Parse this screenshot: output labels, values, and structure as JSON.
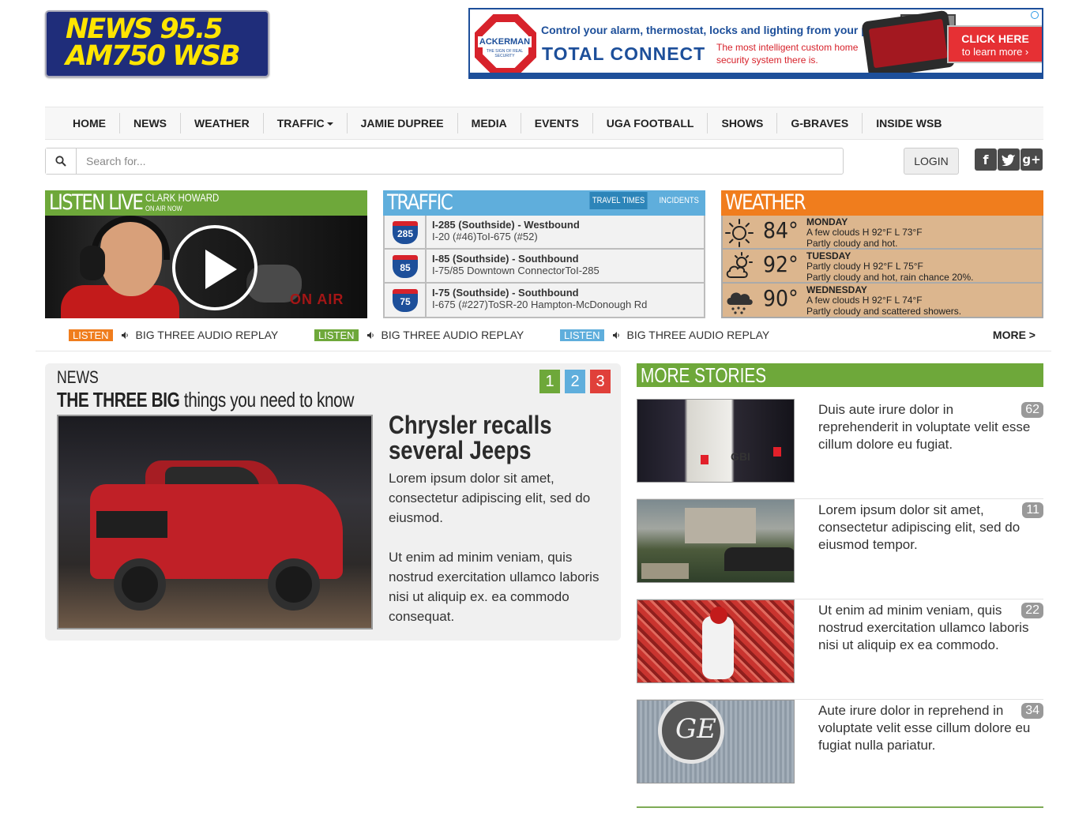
{
  "logo": {
    "line1": "NEWS 95.5",
    "line2": "AM750 WSB"
  },
  "ad": {
    "brand": "ACKERMAN",
    "brand_sub": "THE SIGN OF REAL SECURITY",
    "headline": "Control your alarm, thermostat, locks and lighting from your phone",
    "product": "TOTAL CONNECT",
    "tagline": "The most intelligent custom home security system there is.",
    "cta_line1": "CLICK HERE",
    "cta_line2": "to learn more ›"
  },
  "nav": {
    "items": [
      "HOME",
      "NEWS",
      "WEATHER",
      "TRAFFIC",
      "JAMIE DUPREE",
      "MEDIA",
      "EVENTS",
      "UGA FOOTBALL",
      "SHOWS",
      "G-BRAVES",
      "INSIDE WSB"
    ]
  },
  "search": {
    "placeholder": "Search for..."
  },
  "login_label": "LOGIN",
  "social": [
    "facebook-icon",
    "twitter-icon",
    "google-plus-icon"
  ],
  "listen_live": {
    "title": "LISTEN LIVE",
    "host": "CLARK HOWARD",
    "status": "ON AIR NOW",
    "sign": "ON AIR"
  },
  "traffic": {
    "title": "TRAFFIC",
    "tabs": [
      "TRAVEL TIMES",
      "INCIDENTS"
    ],
    "rows": [
      {
        "shield": "285",
        "route": "I-285 (Southside) - Westbound",
        "detail": "I-20 (#46)ToI-675 (#52)"
      },
      {
        "shield": "85",
        "route": "I-85 (Southside) - Southbound",
        "detail": "I-75/85 Downtown ConnectorToI-285"
      },
      {
        "shield": "75",
        "route": "I-75 (Southside) - Southbound",
        "detail": "I-675 (#227)ToSR-20 Hampton-McDonough Rd"
      }
    ]
  },
  "weather": {
    "title": "WEATHER",
    "days": [
      {
        "icon": "sunny-icon",
        "temp": "84°",
        "day": "MONDAY",
        "hilo": "A few clouds H 92°F L 73°F",
        "desc": "Partly cloudy and hot."
      },
      {
        "icon": "partly-cloudy-icon",
        "temp": "92°",
        "day": "TUESDAY",
        "hilo": "Partly cloudy H 92°F L 75°F",
        "desc": "Partly cloudy and hot, rain chance 20%."
      },
      {
        "icon": "rain-cloud-icon",
        "temp": "90°",
        "day": "WEDNESDAY",
        "hilo": "A few clouds H 92°F L 74°F",
        "desc": "Partly cloudy and scattered showers."
      }
    ]
  },
  "replays": {
    "items": [
      {
        "badge": "LISTEN",
        "text": "BIG THREE AUDIO REPLAY",
        "color": "#f07d1d"
      },
      {
        "badge": "LISTEN",
        "text": "BIG THREE AUDIO REPLAY",
        "color": "#6ea83a"
      },
      {
        "badge": "LISTEN",
        "text": "BIG THREE AUDIO REPLAY",
        "color": "#5faedc"
      }
    ],
    "more": "MORE >"
  },
  "news": {
    "label": "NEWS",
    "subtitle_bold": "THE THREE BIG",
    "subtitle_rest": "things you need to know",
    "pages": [
      {
        "label": "1",
        "color": "#6ea83a"
      },
      {
        "label": "2",
        "color": "#5faedc"
      },
      {
        "label": "3",
        "color": "#e0403a"
      }
    ],
    "headline": "Chrysler recalls several Jeeps",
    "paragraph1": "Lorem ipsum dolor sit amet, consectetur adipiscing elit, sed do eiusmod.",
    "paragraph2": "Ut enim ad minim veniam, quis nostrud exercitation ullamco laboris nisi ut aliquip ex. ea commodo consequat."
  },
  "more_stories": {
    "title": "MORE STORIES",
    "items": [
      {
        "text": "Duis aute irure dolor in reprehenderit in voluptate velit esse cillum dolore eu fugiat.",
        "count": "62",
        "image": "gbi-crime-scene-van"
      },
      {
        "text": "Lorem ipsum dolor sit amet, consectetur adipiscing elit, sed do eiusmod tempor.",
        "count": "11",
        "image": "apartment-complex-night"
      },
      {
        "text": "Ut enim ad minim veniam, quis nostrud exercitation ullamco laboris nisi ut aliquip ex ea commodo.",
        "count": "22",
        "image": "georgia-football-celebration"
      },
      {
        "text": "Aute irure dolor in reprehend in voluptate velit esse cillum dolore eu fugiat nulla pariatur.",
        "count": "34",
        "image": "ge-logo-building"
      }
    ]
  },
  "colors": {
    "listen_green": "#6ea83a",
    "traffic_blue": "#5faedc",
    "weather_orange": "#f07d1d",
    "weather_tan": "#dcb68e",
    "logo_navy": "#1f2d7a",
    "logo_yellow": "#ffe500"
  }
}
